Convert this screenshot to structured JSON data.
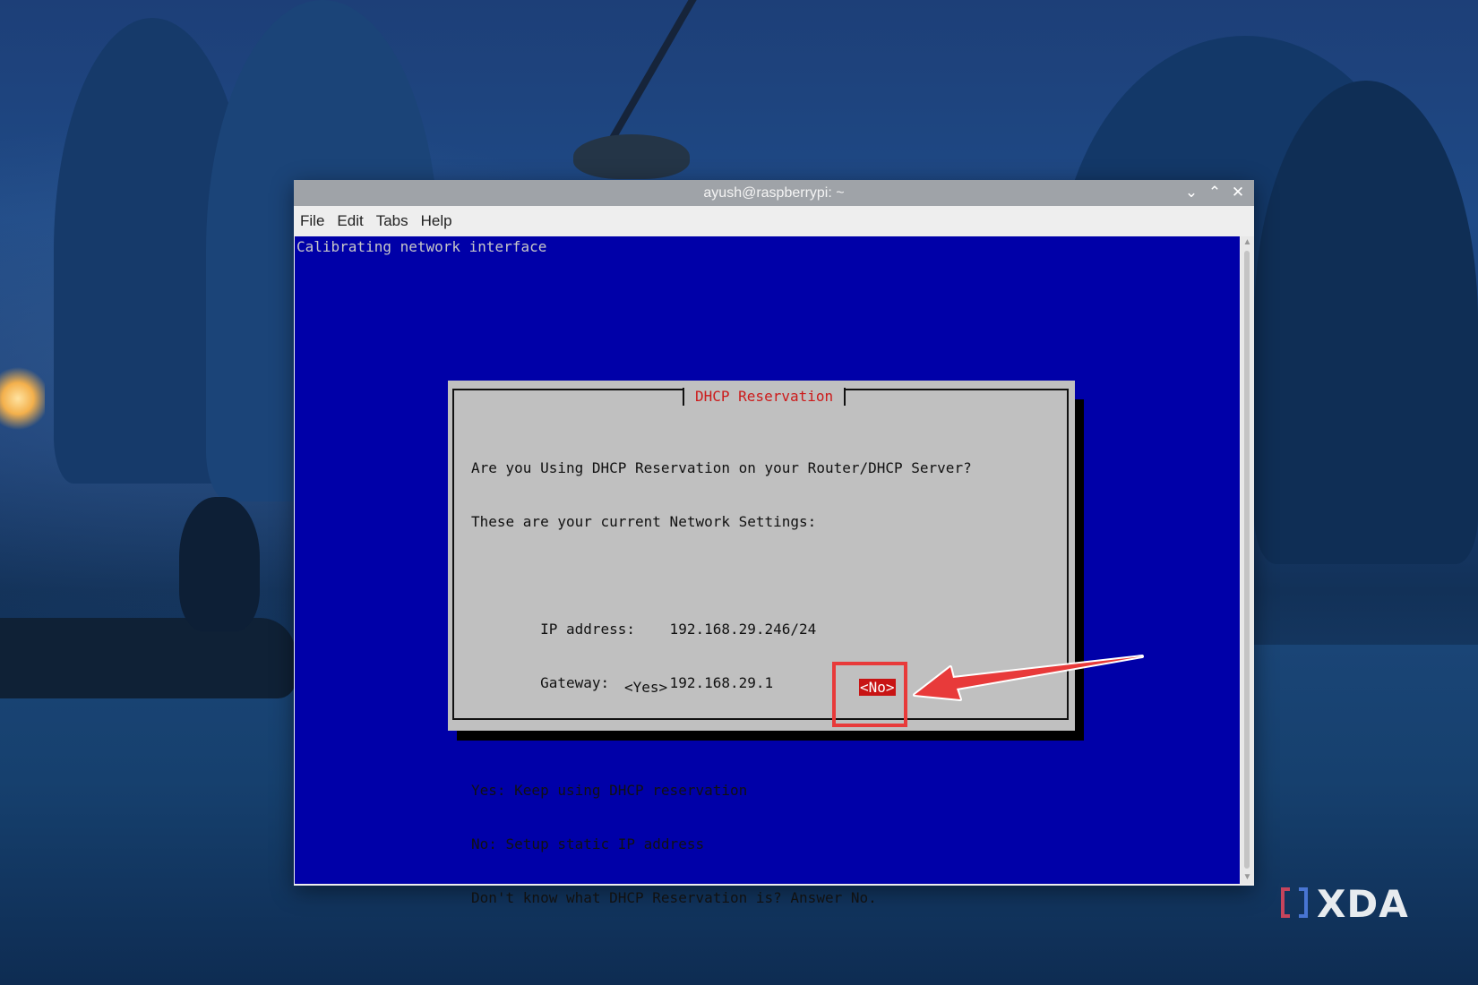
{
  "window": {
    "title": "ayush@raspberrypi: ~",
    "controls": {
      "minimize": "⌄",
      "maximize": "⌃",
      "close": "✕"
    }
  },
  "menubar": {
    "items": [
      "File",
      "Edit",
      "Tabs",
      "Help"
    ]
  },
  "terminal": {
    "status_line": "Calibrating network interface",
    "background_color": "#0000a8"
  },
  "dialog": {
    "title": "DHCP Reservation",
    "lines": [
      "Are you Using DHCP Reservation on your Router/DHCP Server?",
      "These are your current Network Settings:",
      "",
      "        IP address:    192.168.29.246/24",
      "        Gateway:       192.168.29.1",
      "",
      "Yes: Keep using DHCP reservation",
      "No: Setup static IP address",
      "Don't know what DHCP Reservation is? Answer No."
    ],
    "yes_button": "<Yes>",
    "no_button": "<No>",
    "selected_button": "no"
  },
  "annotation": {
    "highlight_color": "#e83a3a"
  },
  "watermark": {
    "text": "XDA"
  }
}
